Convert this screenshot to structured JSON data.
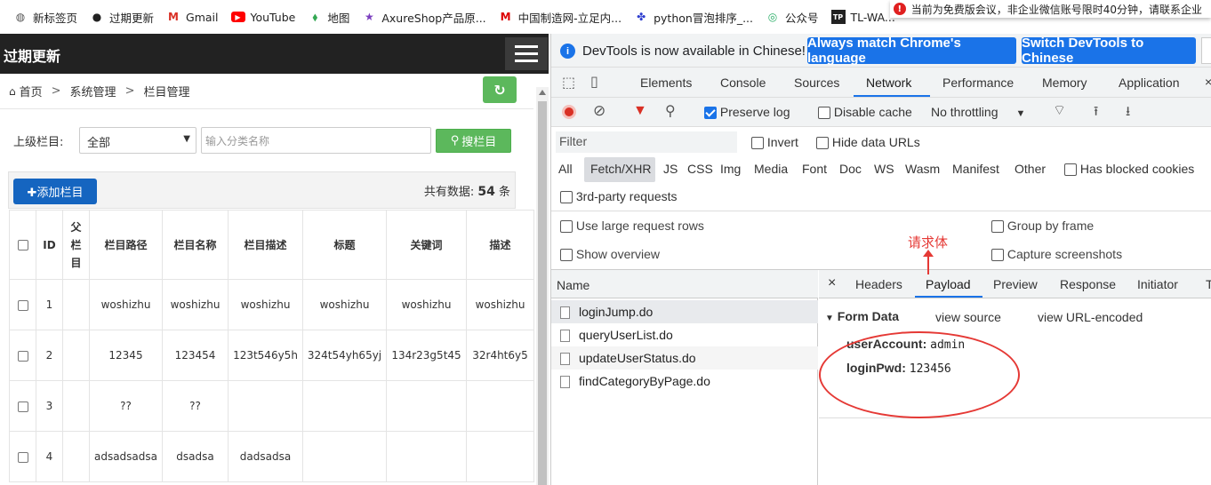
{
  "bookmarks": [
    {
      "label": "新标签页",
      "icon": "globe-icon"
    },
    {
      "label": "过期更新",
      "icon": "github-icon"
    },
    {
      "label": "Gmail",
      "icon": "gmail-icon"
    },
    {
      "label": "YouTube",
      "icon": "youtube-icon"
    },
    {
      "label": "地图",
      "icon": "maps-icon"
    },
    {
      "label": "AxureShop产品原...",
      "icon": "star-icon"
    },
    {
      "label": "中国制造网-立足内...",
      "icon": "mic-icon"
    },
    {
      "label": "python冒泡排序_...",
      "icon": "paw-icon"
    },
    {
      "label": "公众号",
      "icon": "wechat-icon"
    },
    {
      "label": "TL-WA...",
      "icon": "tplink-icon"
    }
  ],
  "notice": {
    "text": "当前为免费版会议，非企业微信账号限时40分钟，请联系企业"
  },
  "app": {
    "title": "过期更新",
    "breadcrumb": [
      "首页",
      "系统管理",
      "栏目管理"
    ],
    "search": {
      "label": "上级栏目:",
      "select_value": "全部",
      "placeholder": "输入分类名称",
      "button": "搜栏目"
    },
    "add_button": "✚添加栏目",
    "total_label": "共有数据:",
    "total_count": "54",
    "total_unit": "条",
    "table": {
      "headers": [
        "ID",
        "父栏目",
        "栏目路径",
        "栏目名称",
        "栏目描述",
        "标题",
        "关键词",
        "描述"
      ],
      "rows": [
        [
          "1",
          "",
          "woshizhu",
          "woshizhu",
          "woshizhu",
          "woshizhu",
          "woshizhu",
          "woshizhu"
        ],
        [
          "2",
          "",
          "12345",
          "123454",
          "123t546y5h",
          "324t54yh65yj",
          "134r23g5t45",
          "32r4ht6y5"
        ],
        [
          "3",
          "",
          "??",
          "??",
          "",
          "",
          "",
          ""
        ],
        [
          "4",
          "",
          "adsadsadsa",
          "dsadsa",
          "dadsadsa",
          "",
          "",
          ""
        ]
      ]
    }
  },
  "devtools": {
    "info_message": "DevTools is now available in Chinese!",
    "btn_match": "Always match Chrome's language",
    "btn_switch": "Switch DevTools to Chinese",
    "tabs": [
      "Elements",
      "Console",
      "Sources",
      "Network",
      "Performance",
      "Memory",
      "Application"
    ],
    "active_tab": "Network",
    "preserve_log": "Preserve log",
    "disable_cache": "Disable cache",
    "throttling": "No throttling",
    "filter_placeholder": "Filter",
    "invert": "Invert",
    "hide_data_urls": "Hide data URLs",
    "types": [
      "All",
      "Fetch/XHR",
      "JS",
      "CSS",
      "Img",
      "Media",
      "Font",
      "Doc",
      "WS",
      "Wasm",
      "Manifest",
      "Other"
    ],
    "has_blocked_cookies": "Has blocked cookies",
    "third_party": "3rd-party requests",
    "use_large_rows": "Use large request rows",
    "show_overview": "Show overview",
    "group_by_frame": "Group by frame",
    "capture_screenshots": "Capture screenshots",
    "name_header": "Name",
    "requests": [
      "loginJump.do",
      "queryUserList.do",
      "updateUserStatus.do",
      "findCategoryByPage.do"
    ],
    "detail_tabs": [
      "Headers",
      "Payload",
      "Preview",
      "Response",
      "Initiator"
    ],
    "form_data_title": "Form Data",
    "view_source": "view source",
    "view_url_encoded": "view URL-encoded",
    "form_fields": [
      {
        "key": "userAccount:",
        "value": "admin"
      },
      {
        "key": "loginPwd:",
        "value": "123456"
      }
    ]
  },
  "annotation": {
    "text": "请求体"
  },
  "colors": {
    "accent": "#1a73e8",
    "success": "#5cb85c",
    "primary": "#1565c0",
    "annotation": "#e53935",
    "topbar": "#222222"
  }
}
